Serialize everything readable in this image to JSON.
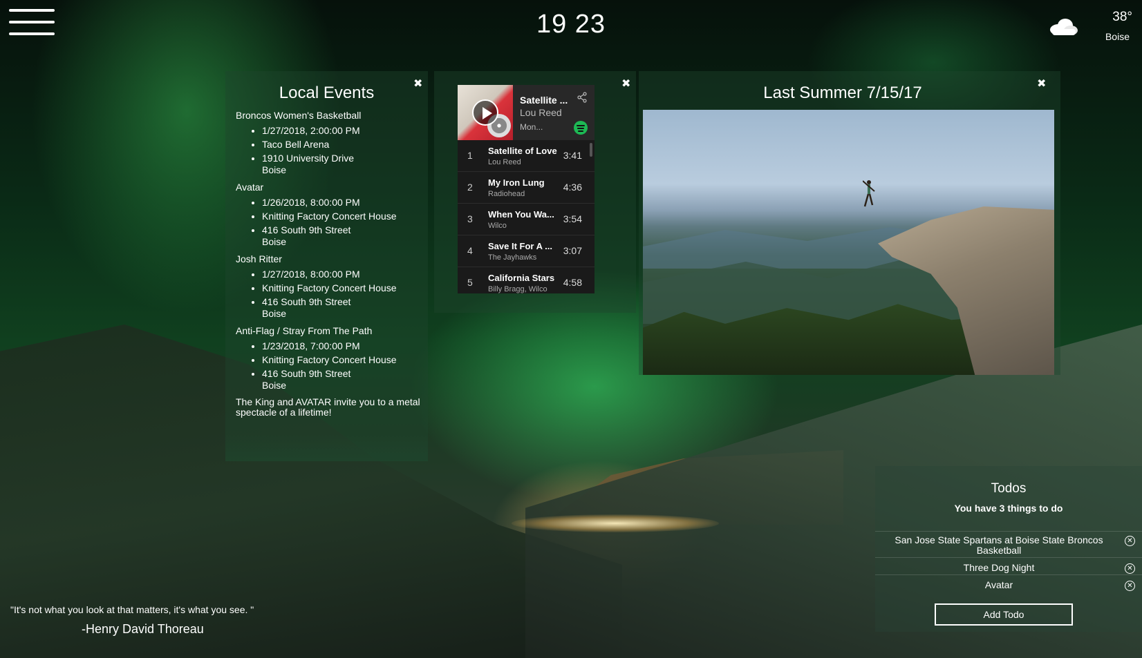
{
  "header": {
    "time": "19 23",
    "weather": {
      "temperature": "38°",
      "city": "Boise",
      "icon": "cloud-icon"
    }
  },
  "events": {
    "title": "Local Events",
    "items": [
      {
        "name": "Broncos Women's Basketball",
        "datetime": "1/27/2018, 2:00:00 PM",
        "venue": "Taco Bell Arena",
        "address": "1910 University Drive",
        "city": "Boise"
      },
      {
        "name": "Avatar",
        "datetime": "1/26/2018, 8:00:00 PM",
        "venue": "Knitting Factory Concert House",
        "address": "416 South 9th Street",
        "city": "Boise"
      },
      {
        "name": "Josh Ritter",
        "datetime": "1/27/2018, 8:00:00 PM",
        "venue": "Knitting Factory Concert House",
        "address": "416 South 9th Street",
        "city": "Boise"
      },
      {
        "name": "Anti-Flag / Stray From The Path",
        "datetime": "1/23/2018, 7:00:00 PM",
        "venue": "Knitting Factory Concert House",
        "address": "416 South 9th Street",
        "city": "Boise"
      }
    ],
    "trailing_text": "The King and AVATAR invite you to a metal spectacle of a lifetime!"
  },
  "spotify": {
    "now_playing": {
      "title": "Satellite ...",
      "artist": "Lou Reed",
      "album": "Mon..."
    },
    "tracks": [
      {
        "num": "1",
        "name": "Satellite of Love",
        "artist": "Lou Reed",
        "duration": "3:41"
      },
      {
        "num": "2",
        "name": "My Iron Lung",
        "artist": "Radiohead",
        "duration": "4:36"
      },
      {
        "num": "3",
        "name": "When You Wa...",
        "artist": "Wilco",
        "duration": "3:54"
      },
      {
        "num": "4",
        "name": "Save It For A ...",
        "artist": "The Jayhawks",
        "duration": "3:07"
      },
      {
        "num": "5",
        "name": "California Stars",
        "artist": "Billy Bragg, Wilco",
        "duration": "4:58"
      }
    ]
  },
  "photo": {
    "title": "Last Summer 7/15/17"
  },
  "todos": {
    "title": "Todos",
    "count_text": "You have 3 things to do",
    "items": [
      {
        "label": "San Jose State Spartans at Boise State Broncos Basketball"
      },
      {
        "label": "Three Dog Night"
      },
      {
        "label": "Avatar"
      }
    ],
    "add_label": "Add Todo"
  },
  "quote": {
    "text": "\"It's not what you look at that matters, it's what you see. \"",
    "author": "-Henry David Thoreau"
  }
}
